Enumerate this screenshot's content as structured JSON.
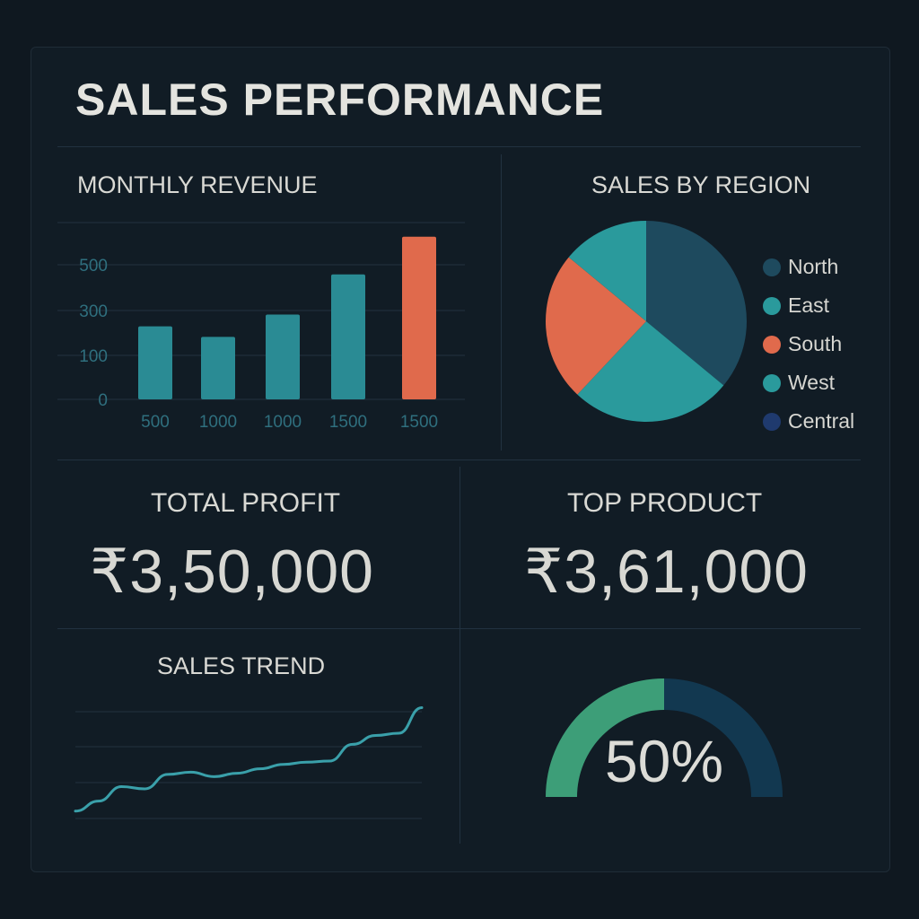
{
  "dashboard": {
    "title": "SALES PERFORMANCE"
  },
  "colors": {
    "teal": "#2a9a9c",
    "orange": "#e06a4c",
    "dark_teal": "#1e4a5e",
    "navy": "#1f3a6e",
    "green": "#3d9e78",
    "gauge_bg": "#123850"
  },
  "monthly_revenue": {
    "title": "MONTHLY REVENUE"
  },
  "sales_by_region": {
    "title": "SALES BY REGION"
  },
  "total_profit": {
    "title": "TOTAL PROFIT",
    "value": "₹3,50,000"
  },
  "top_product": {
    "title": "TOP PRODUCT",
    "value": "₹3,61,000"
  },
  "sales_trend": {
    "title": "SALES TREND"
  },
  "gauge": {
    "value_label": "50%"
  },
  "chart_data": [
    {
      "type": "bar",
      "title": "MONTHLY REVENUE",
      "categories": [
        "500",
        "1000",
        "1000",
        "1500",
        "1500"
      ],
      "values": [
        310,
        265,
        360,
        530,
        690
      ],
      "highlight_index": 4,
      "yticks": [
        "0",
        "100",
        "300",
        "500"
      ],
      "grid": true
    },
    {
      "type": "pie",
      "title": "SALES BY REGION",
      "slices": [
        {
          "label": "North",
          "value": 36,
          "color": "#1e4a5e"
        },
        {
          "label": "East",
          "value": 26,
          "color": "#2a9a9c"
        },
        {
          "label": "South",
          "value": 24,
          "color": "#e06a4c"
        },
        {
          "label": "West",
          "value": 14,
          "color": "#2a9a9c"
        }
      ],
      "legend": [
        {
          "label": "North",
          "color": "#1e4a5e"
        },
        {
          "label": "East",
          "color": "#2a9a9c"
        },
        {
          "label": "South",
          "color": "#e06a4c"
        },
        {
          "label": "West",
          "color": "#2a9a9c"
        },
        {
          "label": "Central",
          "color": "#1f3a6e"
        }
      ],
      "legend_position": "right"
    },
    {
      "type": "line",
      "title": "SALES TREND",
      "values": [
        5,
        14,
        27,
        25,
        38,
        40,
        36,
        39,
        43,
        47,
        49,
        50,
        65,
        73,
        75,
        98
      ],
      "ylim": [
        0,
        100
      ],
      "grid": true
    },
    {
      "type": "gauge",
      "value": 50,
      "max": 100
    }
  ]
}
